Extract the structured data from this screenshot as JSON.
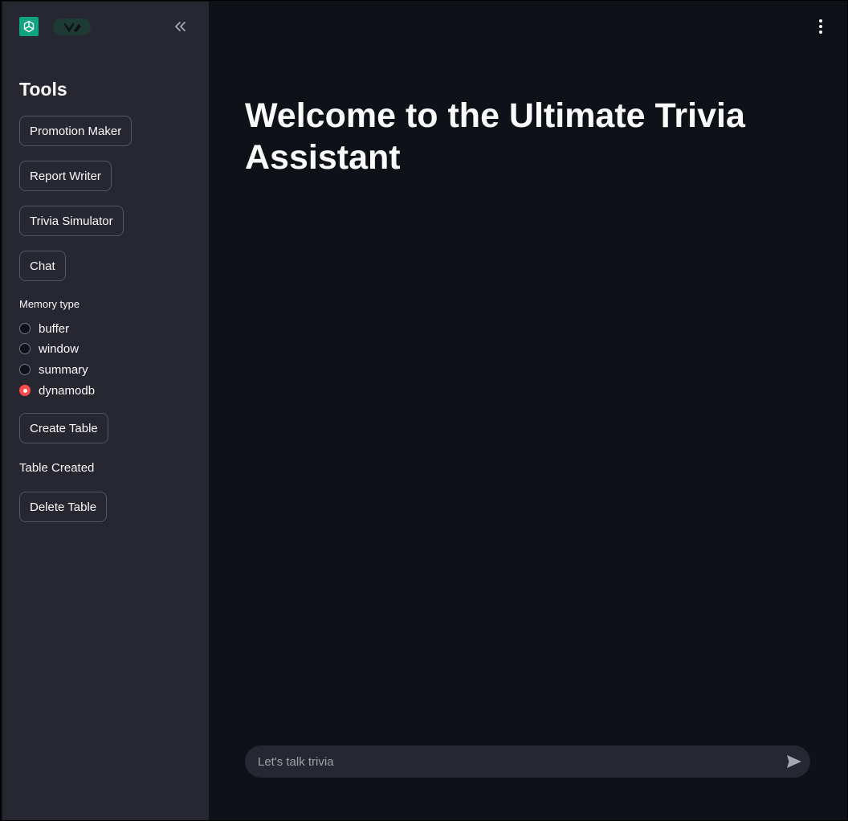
{
  "sidebar": {
    "logo_icon": "openai-logo-icon",
    "badge_icon": "streamlit-badge-icon",
    "collapse_icon": "double-chevron-left-icon",
    "title": "Tools",
    "buttons": [
      {
        "label": "Promotion Maker"
      },
      {
        "label": "Report Writer"
      },
      {
        "label": "Trivia Simulator"
      },
      {
        "label": "Chat"
      }
    ],
    "memory": {
      "label": "Memory type",
      "options": [
        "buffer",
        "window",
        "summary",
        "dynamodb"
      ],
      "selected": "dynamodb"
    },
    "create_table_label": "Create Table",
    "status_text": "Table Created",
    "delete_table_label": "Delete Table"
  },
  "main": {
    "menu_icon": "kebab-menu-icon",
    "title": "Welcome to the Ultimate Trivia Assistant",
    "chat": {
      "placeholder": "Let's talk trivia",
      "value": "",
      "send_icon": "send-icon"
    }
  },
  "colors": {
    "main_bg": "#0e1117",
    "sidebar_bg": "#262730",
    "accent": "#ff4b4b",
    "logo_bg": "#10a37f",
    "text": "#fafafa"
  }
}
